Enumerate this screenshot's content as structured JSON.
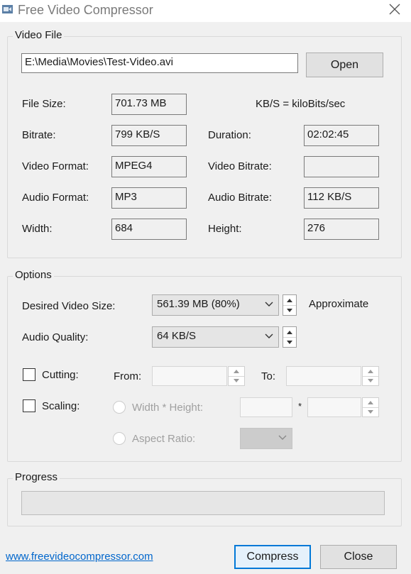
{
  "window": {
    "title": "Free Video Compressor",
    "app_icon": "video-camera-icon",
    "close_icon": "close-icon"
  },
  "video_file": {
    "legend": "Video File",
    "path": "E:\\Media\\Movies\\Test-Video.avi",
    "open_label": "Open",
    "units_note": "KB/S = kiloBits/sec",
    "file_size": {
      "label": "File Size:",
      "value": "701.73 MB"
    },
    "bitrate": {
      "label": "Bitrate:",
      "value": "799 KB/S"
    },
    "duration": {
      "label": "Duration:",
      "value": "02:02:45"
    },
    "video_format": {
      "label": "Video Format:",
      "value": "MPEG4"
    },
    "video_bitrate": {
      "label": "Video Bitrate:",
      "value": ""
    },
    "audio_format": {
      "label": "Audio Format:",
      "value": "MP3"
    },
    "audio_bitrate": {
      "label": "Audio Bitrate:",
      "value": "112 KB/S"
    },
    "width": {
      "label": "Width:",
      "value": "684"
    },
    "height": {
      "label": "Height:",
      "value": "276"
    }
  },
  "options": {
    "legend": "Options",
    "desired_size": {
      "label": "Desired Video Size:",
      "value": "561.39 MB (80%)",
      "note": "Approximate"
    },
    "audio_quality": {
      "label": "Audio Quality:",
      "value": "64 KB/S"
    },
    "cutting": {
      "label": "Cutting:",
      "checked": false,
      "from_label": "From:",
      "to_label": "To:",
      "from_value": "",
      "to_value": ""
    },
    "scaling": {
      "label": "Scaling:",
      "checked": false,
      "width_height_label": "Width * Height:",
      "times_symbol": "*",
      "width_value": "",
      "height_value": "",
      "aspect_ratio_label": "Aspect Ratio:",
      "aspect_ratio_value": ""
    }
  },
  "progress": {
    "legend": "Progress",
    "fraction": 0
  },
  "footer": {
    "website": "www.freevideocompressor.com",
    "compress_label": "Compress",
    "close_label": "Close"
  }
}
